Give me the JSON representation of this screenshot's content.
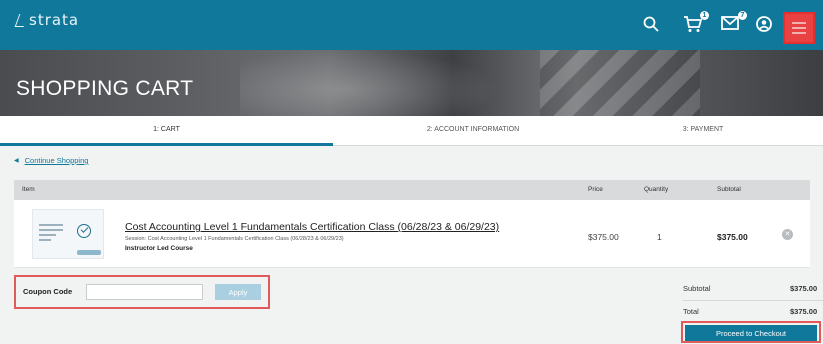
{
  "header": {
    "logo_text": "strata",
    "cart_count": "1",
    "messages_count": "7"
  },
  "hero": {
    "title": "SHOPPING CART"
  },
  "steps": [
    {
      "label": "1: CART",
      "active": true
    },
    {
      "label": "2: ACCOUNT INFORMATION",
      "active": false
    },
    {
      "label": "3: PAYMENT",
      "active": false
    }
  ],
  "continue_link": "Continue Shopping",
  "table": {
    "headers": {
      "item": "Item",
      "price": "Price",
      "quantity": "Quantity",
      "subtotal": "Subtotal"
    },
    "rows": [
      {
        "title": "Cost Accounting Level 1 Fundamentals Certification Class (06/28/23 & 06/29/23)",
        "session": "Session: Cost Accounting Level 1 Fundamentals Certification Class (06/28/23 & 06/29/23)",
        "type": "Instructor Led Course",
        "price": "$375.00",
        "quantity": "1",
        "subtotal": "$375.00"
      }
    ]
  },
  "coupon": {
    "label": "Coupon Code",
    "value": "",
    "placeholder": "",
    "apply_label": "Apply"
  },
  "totals": {
    "subtotal_label": "Subtotal",
    "subtotal_value": "$375.00",
    "total_label": "Total",
    "total_value": "$375.00",
    "checkout_label": "Proceed to Checkout"
  },
  "colors": {
    "brand": "#10789a",
    "highlight": "#e05a5a",
    "apply_button": "#a9cfe0"
  }
}
